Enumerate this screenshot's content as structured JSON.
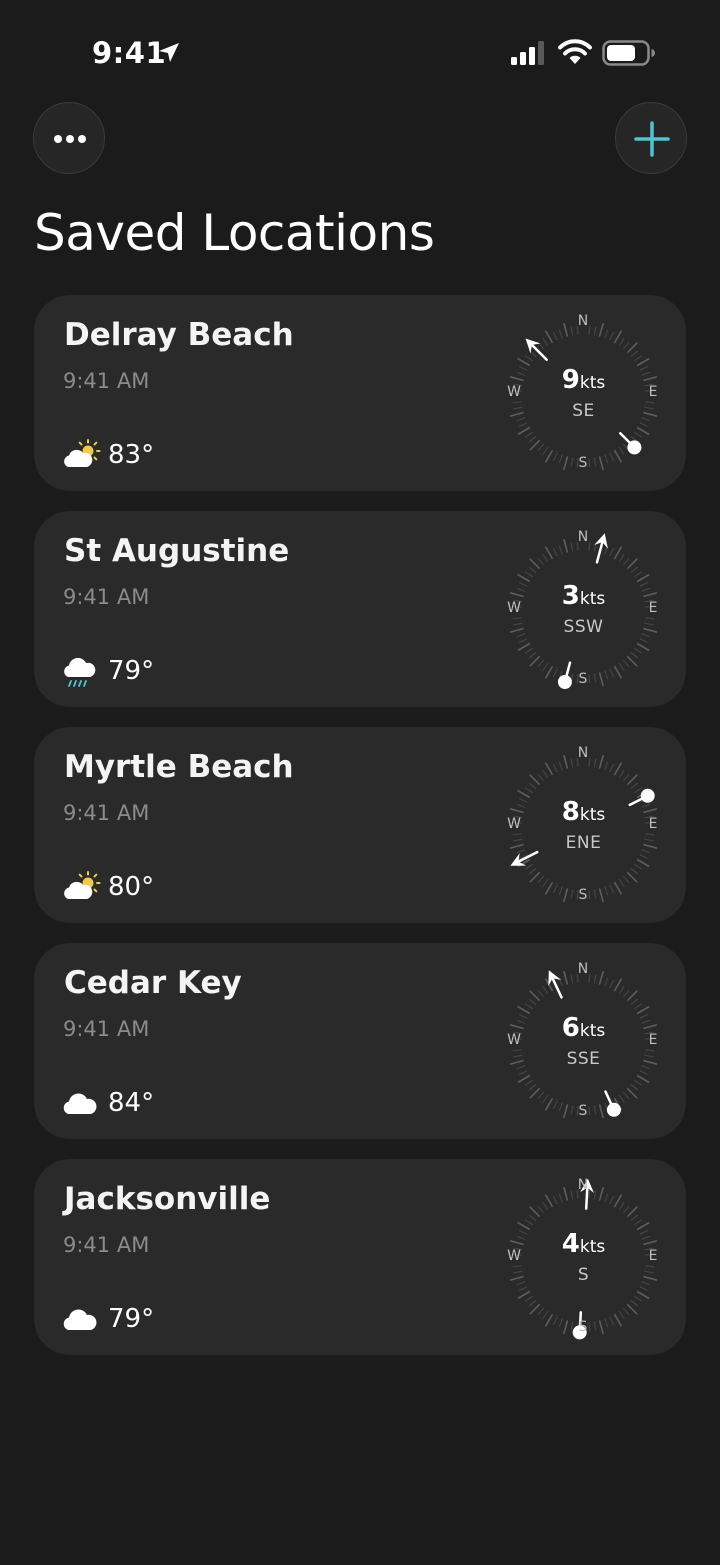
{
  "status_bar": {
    "time": "9:41"
  },
  "header": {
    "title": "Saved Locations"
  },
  "colors": {
    "accent": "#4fc3d1",
    "card_bg": "#2a2a2a",
    "background": "#1b1b1b"
  },
  "compass_labels": {
    "n": "N",
    "e": "E",
    "s": "S",
    "w": "W"
  },
  "locations": [
    {
      "name": "Delray Beach",
      "time": "9:41 AM",
      "weather_icon": "partly-sunny-icon",
      "temp": "83°",
      "speed": "9",
      "unit": "kts",
      "direction": "SE",
      "wind_from_deg": 135
    },
    {
      "name": "St Augustine",
      "time": "9:41 AM",
      "weather_icon": "rain-cloud-icon",
      "temp": "79°",
      "speed": "3",
      "unit": "kts",
      "direction": "SSW",
      "wind_from_deg": 195
    },
    {
      "name": "Myrtle Beach",
      "time": "9:41 AM",
      "weather_icon": "partly-sunny-icon",
      "temp": "80°",
      "speed": "8",
      "unit": "kts",
      "direction": "ENE",
      "wind_from_deg": 63
    },
    {
      "name": "Cedar Key",
      "time": "9:41 AM",
      "weather_icon": "cloud-icon",
      "temp": "84°",
      "speed": "6",
      "unit": "kts",
      "direction": "SSE",
      "wind_from_deg": 155
    },
    {
      "name": "Jacksonville",
      "time": "9:41 AM",
      "weather_icon": "cloud-icon",
      "temp": "79°",
      "speed": "4",
      "unit": "kts",
      "direction": "S",
      "wind_from_deg": 183
    }
  ]
}
